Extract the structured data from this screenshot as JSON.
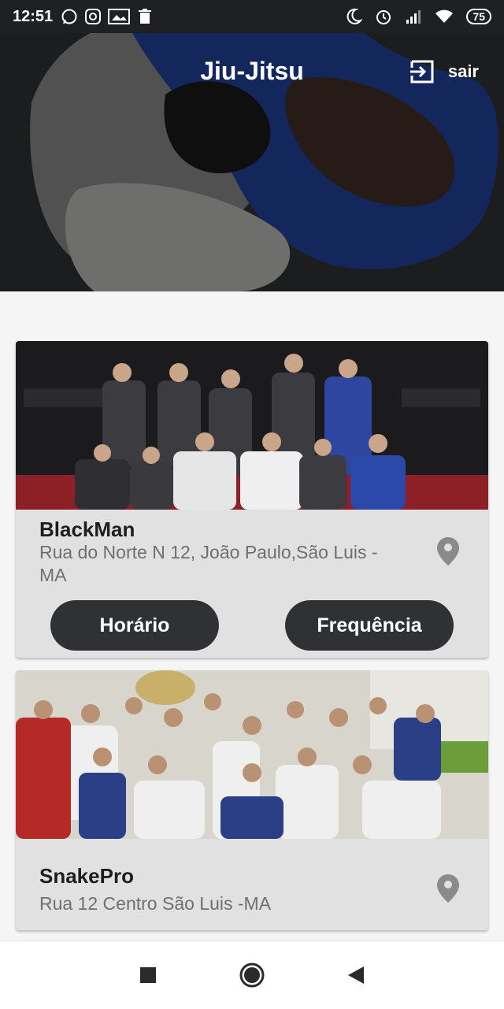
{
  "status_bar": {
    "time": "12:51",
    "battery": "75",
    "icons_left": [
      "whatsapp-icon",
      "instagram-icon",
      "photo-icon",
      "trash-icon"
    ],
    "icons_right": [
      "moon-icon",
      "alarm-icon",
      "signal-icon",
      "wifi-icon"
    ]
  },
  "header": {
    "title": "Jiu-Jitsu",
    "logout_label": "sair"
  },
  "academies": [
    {
      "name": "BlackMan",
      "address": "Rua do Norte N 12, João Paulo,São Luis - MA",
      "schedule_label": "Horário",
      "attendance_label": "Frequência"
    },
    {
      "name": "SnakePro",
      "address": "Rua 12 Centro São Luis -MA"
    }
  ],
  "nav": {
    "buttons": [
      "recents-icon",
      "home-icon",
      "back-icon"
    ]
  },
  "colors": {
    "card_bg": "#e1e1e1",
    "button_bg": "#2f3134",
    "status_bar_bg": "#1f2022"
  }
}
